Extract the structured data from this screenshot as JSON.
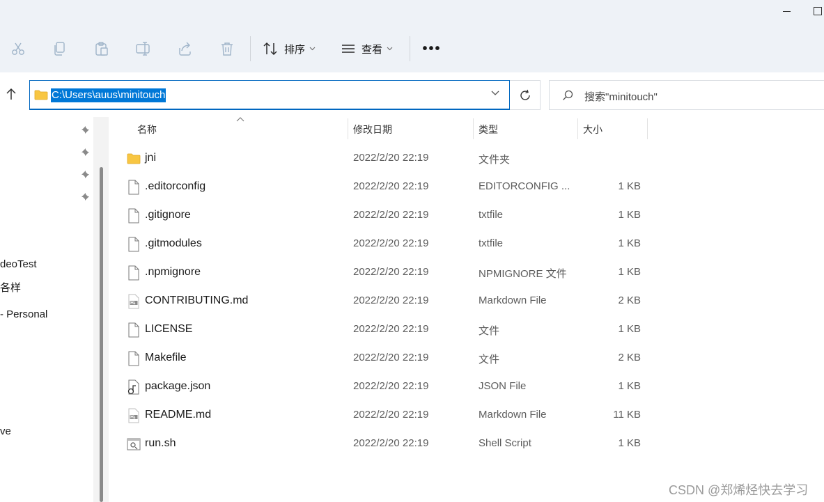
{
  "toolbar": {
    "icons": [
      "cut-icon",
      "copy-icon",
      "paste-icon",
      "rename-icon",
      "share-icon",
      "delete-icon"
    ],
    "sort_label": "排序",
    "view_label": "查看",
    "more_label": "•••"
  },
  "address": {
    "path": "C:\\Users\\auus\\minitouch",
    "search_placeholder": "搜索\"minitouch\""
  },
  "nav": {
    "items": [
      {
        "label": "deoTest"
      },
      {
        "label": "各样"
      },
      {
        "label": "- Personal"
      },
      {
        "label": "ve"
      }
    ]
  },
  "columns": {
    "name": "名称",
    "date": "修改日期",
    "type": "类型",
    "size": "大小"
  },
  "files": [
    {
      "name": "jni",
      "date": "2022/2/20 22:19",
      "type": "文件夹",
      "size": "",
      "icon": "folder-icon"
    },
    {
      "name": ".editorconfig",
      "date": "2022/2/20 22:19",
      "type": "EDITORCONFIG ...",
      "size": "1 KB",
      "icon": "file-icon"
    },
    {
      "name": ".gitignore",
      "date": "2022/2/20 22:19",
      "type": "txtfile",
      "size": "1 KB",
      "icon": "file-icon"
    },
    {
      "name": ".gitmodules",
      "date": "2022/2/20 22:19",
      "type": "txtfile",
      "size": "1 KB",
      "icon": "file-icon"
    },
    {
      "name": ".npmignore",
      "date": "2022/2/20 22:19",
      "type": "NPMIGNORE 文件",
      "size": "1 KB",
      "icon": "file-icon"
    },
    {
      "name": "CONTRIBUTING.md",
      "date": "2022/2/20 22:19",
      "type": "Markdown File",
      "size": "2 KB",
      "icon": "markdown-file-icon"
    },
    {
      "name": "LICENSE",
      "date": "2022/2/20 22:19",
      "type": "文件",
      "size": "1 KB",
      "icon": "file-icon"
    },
    {
      "name": "Makefile",
      "date": "2022/2/20 22:19",
      "type": "文件",
      "size": "2 KB",
      "icon": "file-icon"
    },
    {
      "name": "package.json",
      "date": "2022/2/20 22:19",
      "type": "JSON File",
      "size": "1 KB",
      "icon": "json-file-icon"
    },
    {
      "name": "README.md",
      "date": "2022/2/20 22:19",
      "type": "Markdown File",
      "size": "11 KB",
      "icon": "markdown-file-icon"
    },
    {
      "name": "run.sh",
      "date": "2022/2/20 22:19",
      "type": "Shell Script",
      "size": "1 KB",
      "icon": "shell-script-icon"
    }
  ],
  "watermark": "CSDN @郑烯烃快去学习",
  "colors": {
    "accent": "#0067c0",
    "selection": "#0078d7",
    "folder": "#f8c642",
    "toolbar_bg": "#eef2f7"
  }
}
